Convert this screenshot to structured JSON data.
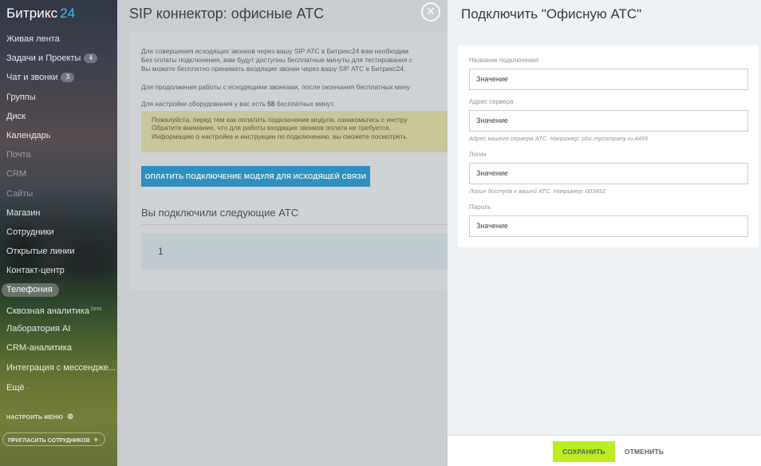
{
  "sidebar": {
    "logo_text": "Битрикс",
    "logo_number": "24",
    "items": [
      {
        "label": "Живая лента"
      },
      {
        "label": "Задачи и Проекты",
        "counter": "4"
      },
      {
        "label": "Чат и звонки",
        "counter": "3"
      },
      {
        "label": "Группы"
      },
      {
        "label": "Диск"
      },
      {
        "label": "Календарь"
      },
      {
        "label": "Почта"
      },
      {
        "label": "CRM"
      },
      {
        "label": "Сайты"
      },
      {
        "label": "Магазин"
      },
      {
        "label": "Сотрудники"
      },
      {
        "label": "Открытые линии"
      },
      {
        "label": "Контакт-центр"
      },
      {
        "label": "Телефония",
        "active": true
      },
      {
        "label": "Сквозная аналитика",
        "badge": "beta"
      },
      {
        "label": "Лаборатория AI"
      },
      {
        "label": "CRM-аналитика"
      },
      {
        "label": "Интеграция с мессендже..."
      },
      {
        "label": "Ещё"
      }
    ],
    "settings_link": "НАСТРОИТЬ МЕНЮ",
    "invite_button": "ПРИГЛАСИТЬ СОТРУДНИКОВ"
  },
  "page": {
    "title": "SIP коннектор: офисные АТС",
    "close_icon": "close-icon",
    "intro_lines": [
      "Для совершения исходящих звонков через вашу SIP АТС в Битрикс24 вам необходим",
      "Без оплаты подключения, вам будут доступны бесплатные минуты для тестирования с",
      "Вы можете бесплатно принимать входящие звонки через вашу SIP АТС в Битрикс24."
    ],
    "continue_line": "Для продолжения работы с исходящими звонками, после окончания бесплатных мину",
    "minutes_prefix": "Для настройки оборудования у вас есть",
    "minutes_value": "58",
    "minutes_suffix": "бесплатных минут.",
    "warning_lines": [
      "Пожалуйста, перед тем как оплатить подключение модуля, ознакомьтесь с инстру",
      "Обратите внимание, что для работы входящих звонков оплата не требуется.",
      "Информацию о настройке и инструкции по подключению, вы сможете посмотреть"
    ],
    "pay_button": "ОПЛАТИТЬ ПОДКЛЮЧЕНИЕ МОДУЛЯ ДЛЯ ИСХОДЯЩЕЙ СВЯЗИ",
    "connected_title": "Вы подключили следующие АТС",
    "connected_rows": [
      "1"
    ]
  },
  "slider": {
    "title": "Подключить \"Офисную АТС\"",
    "fields": {
      "name": {
        "label": "Название подключения",
        "value": "Значение"
      },
      "server": {
        "label": "Адрес сервера",
        "value": "Значение",
        "hint": "Адрес вашего сервера АТС. Например: pbx.mycompany.ru:4455"
      },
      "login": {
        "label": "Логин",
        "value": "Значение",
        "hint": "Логин доступа к вашей АТС. Например: 003452"
      },
      "password": {
        "label": "Пароль",
        "value": "Значение"
      }
    },
    "save_button": "СОХРАНИТЬ",
    "cancel_button": "ОТМЕНИТЬ"
  }
}
